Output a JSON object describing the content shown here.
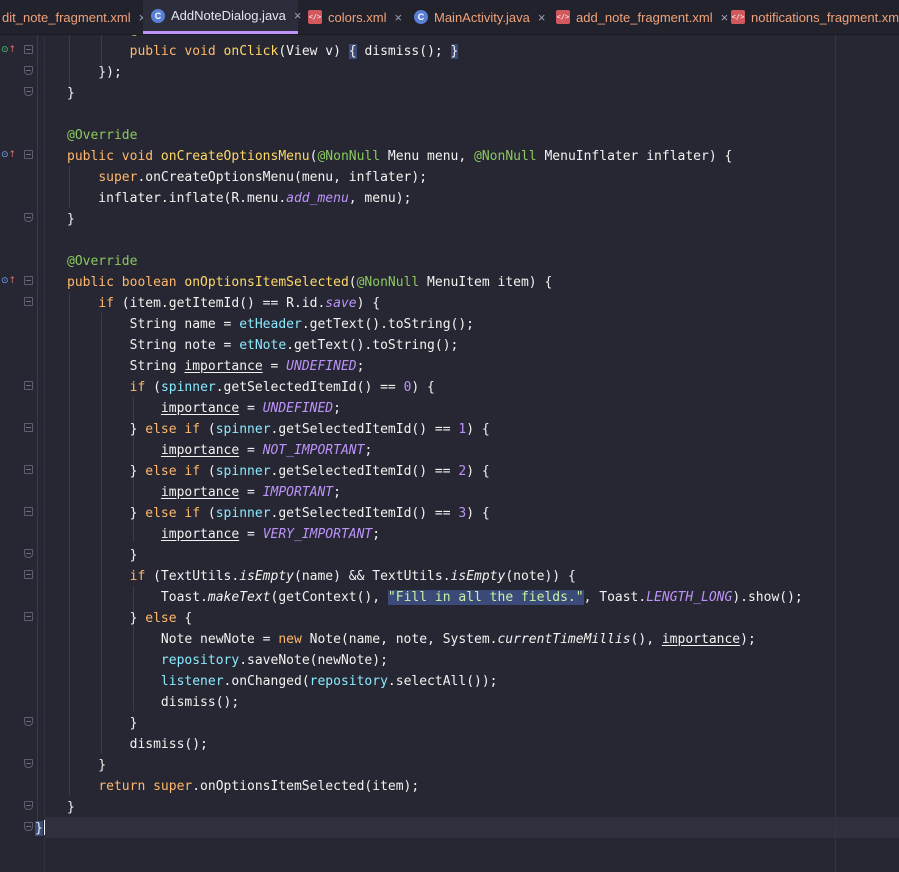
{
  "tabs": [
    {
      "label": "dit_note_fragment.xml",
      "kind": "xml",
      "active": false
    },
    {
      "label": "AddNoteDialog.java",
      "kind": "java",
      "active": true
    },
    {
      "label": "colors.xml",
      "kind": "xml",
      "active": false
    },
    {
      "label": "MainActivity.java",
      "kind": "java",
      "active": false
    },
    {
      "label": "add_note_fragment.xml",
      "kind": "xml",
      "active": false
    },
    {
      "label": "notifications_fragment.xml",
      "kind": "xml",
      "active": false
    }
  ],
  "tab_close_glyph": "×",
  "icons": {
    "java": "class-c-icon",
    "xml": "xml-file-icon",
    "override": "override-method-icon",
    "fold": "fold-toggle-icon"
  },
  "colors": {
    "background": "#262733",
    "keyword": "#ffb86c",
    "annotation": "#8cc85f",
    "function": "#ffd866",
    "field": "#8be9fd",
    "constant": "#bd93f9",
    "string": "#c4f5a0",
    "tab_accent": "#bd93f9"
  },
  "code": {
    "lines": [
      [
        {
          "t": "        "
        },
        {
          "t": "@Override",
          "c": "an"
        }
      ],
      [
        {
          "t": "        "
        },
        {
          "t": "public void ",
          "c": "kw"
        },
        {
          "t": "onClick",
          "c": "fn"
        },
        {
          "t": "(View v) "
        },
        {
          "t": "{",
          "c": "hl"
        },
        {
          "t": " dismiss(); "
        },
        {
          "t": "}",
          "c": "hl"
        }
      ],
      [
        {
          "t": "    });"
        }
      ],
      [
        {
          "t": "}"
        }
      ],
      [
        {
          "t": ""
        }
      ],
      [
        {
          "t": "@Override",
          "c": "an"
        }
      ],
      [
        {
          "t": "public void ",
          "c": "kw"
        },
        {
          "t": "onCreateOptionsMenu",
          "c": "fn"
        },
        {
          "t": "("
        },
        {
          "t": "@NonNull",
          "c": "an"
        },
        {
          "t": " Menu menu, "
        },
        {
          "t": "@NonNull",
          "c": "an"
        },
        {
          "t": " MenuInflater inflater) {"
        }
      ],
      [
        {
          "t": "    "
        },
        {
          "t": "super",
          "c": "kw"
        },
        {
          "t": ".onCreateOptionsMenu(menu, inflater);"
        }
      ],
      [
        {
          "t": "    inflater.inflate(R.menu."
        },
        {
          "t": "add_menu",
          "c": "con"
        },
        {
          "t": ", menu);"
        }
      ],
      [
        {
          "t": "}"
        }
      ],
      [
        {
          "t": ""
        }
      ],
      [
        {
          "t": "@Override",
          "c": "an"
        }
      ],
      [
        {
          "t": "public boolean ",
          "c": "kw"
        },
        {
          "t": "onOptionsItemSelected",
          "c": "fn"
        },
        {
          "t": "("
        },
        {
          "t": "@NonNull",
          "c": "an"
        },
        {
          "t": " MenuItem item) {"
        }
      ],
      [
        {
          "t": "    "
        },
        {
          "t": "if ",
          "c": "kw"
        },
        {
          "t": "(item.getItemId() == R.id."
        },
        {
          "t": "save",
          "c": "con"
        },
        {
          "t": ") {"
        }
      ],
      [
        {
          "t": "        String name = "
        },
        {
          "t": "etHeader",
          "c": "fld"
        },
        {
          "t": ".getText().toString();"
        }
      ],
      [
        {
          "t": "        String note = "
        },
        {
          "t": "etNote",
          "c": "fld"
        },
        {
          "t": ".getText().toString();"
        }
      ],
      [
        {
          "t": "        String "
        },
        {
          "t": "importance",
          "c": "ul"
        },
        {
          "t": " = "
        },
        {
          "t": "UNDEFINED",
          "c": "con"
        },
        {
          "t": ";"
        }
      ],
      [
        {
          "t": "        "
        },
        {
          "t": "if ",
          "c": "kw"
        },
        {
          "t": "("
        },
        {
          "t": "spinner",
          "c": "fld"
        },
        {
          "t": ".getSelectedItemId() == "
        },
        {
          "t": "0",
          "c": "num"
        },
        {
          "t": ") {"
        }
      ],
      [
        {
          "t": "            "
        },
        {
          "t": "importance",
          "c": "ul"
        },
        {
          "t": " = "
        },
        {
          "t": "UNDEFINED",
          "c": "con"
        },
        {
          "t": ";"
        }
      ],
      [
        {
          "t": "        } "
        },
        {
          "t": "else if ",
          "c": "kw"
        },
        {
          "t": "("
        },
        {
          "t": "spinner",
          "c": "fld"
        },
        {
          "t": ".getSelectedItemId() == "
        },
        {
          "t": "1",
          "c": "num"
        },
        {
          "t": ") {"
        }
      ],
      [
        {
          "t": "            "
        },
        {
          "t": "importance",
          "c": "ul"
        },
        {
          "t": " = "
        },
        {
          "t": "NOT_IMPORTANT",
          "c": "con"
        },
        {
          "t": ";"
        }
      ],
      [
        {
          "t": "        } "
        },
        {
          "t": "else if ",
          "c": "kw"
        },
        {
          "t": "("
        },
        {
          "t": "spinner",
          "c": "fld"
        },
        {
          "t": ".getSelectedItemId() == "
        },
        {
          "t": "2",
          "c": "num"
        },
        {
          "t": ") {"
        }
      ],
      [
        {
          "t": "            "
        },
        {
          "t": "importance",
          "c": "ul"
        },
        {
          "t": " = "
        },
        {
          "t": "IMPORTANT",
          "c": "con"
        },
        {
          "t": ";"
        }
      ],
      [
        {
          "t": "        } "
        },
        {
          "t": "else if ",
          "c": "kw"
        },
        {
          "t": "("
        },
        {
          "t": "spinner",
          "c": "fld"
        },
        {
          "t": ".getSelectedItemId() == "
        },
        {
          "t": "3",
          "c": "num"
        },
        {
          "t": ") {"
        }
      ],
      [
        {
          "t": "            "
        },
        {
          "t": "importance",
          "c": "ul"
        },
        {
          "t": " = "
        },
        {
          "t": "VERY_IMPORTANT",
          "c": "con"
        },
        {
          "t": ";"
        }
      ],
      [
        {
          "t": "        }"
        }
      ],
      [
        {
          "t": "        "
        },
        {
          "t": "if ",
          "c": "kw"
        },
        {
          "t": "(TextUtils."
        },
        {
          "t": "isEmpty",
          "c": "sm"
        },
        {
          "t": "(name) && TextUtils."
        },
        {
          "t": "isEmpty",
          "c": "sm"
        },
        {
          "t": "(note)) {"
        }
      ],
      [
        {
          "t": "            Toast."
        },
        {
          "t": "makeText",
          "c": "sm"
        },
        {
          "t": "(getContext(), "
        },
        {
          "t": "\"Fill in all the fields.\"",
          "c": "str hl"
        },
        {
          "t": ", Toast."
        },
        {
          "t": "LENGTH_LONG",
          "c": "con"
        },
        {
          "t": ").show();"
        }
      ],
      [
        {
          "t": "        } "
        },
        {
          "t": "else ",
          "c": "kw"
        },
        {
          "t": "{"
        }
      ],
      [
        {
          "t": "            Note newNote = "
        },
        {
          "t": "new ",
          "c": "kw"
        },
        {
          "t": "Note(name, note, System."
        },
        {
          "t": "currentTimeMillis",
          "c": "sm"
        },
        {
          "t": "(), "
        },
        {
          "t": "importance",
          "c": "ul"
        },
        {
          "t": ");"
        }
      ],
      [
        {
          "t": "            "
        },
        {
          "t": "repository",
          "c": "fld"
        },
        {
          "t": ".saveNote(newNote);"
        }
      ],
      [
        {
          "t": "            "
        },
        {
          "t": "listener",
          "c": "fld"
        },
        {
          "t": ".onChanged("
        },
        {
          "t": "repository",
          "c": "fld"
        },
        {
          "t": ".selectAll());"
        }
      ],
      [
        {
          "t": "            dismiss();"
        }
      ],
      [
        {
          "t": "        }"
        }
      ],
      [
        {
          "t": "        dismiss();"
        }
      ],
      [
        {
          "t": "    }"
        }
      ],
      [
        {
          "t": "    "
        },
        {
          "t": "return super",
          "c": "kw"
        },
        {
          "t": ".onOptionsItemSelected(item);"
        }
      ],
      [
        {
          "t": "}"
        }
      ],
      [
        {
          "t": "}"
        }
      ]
    ]
  }
}
